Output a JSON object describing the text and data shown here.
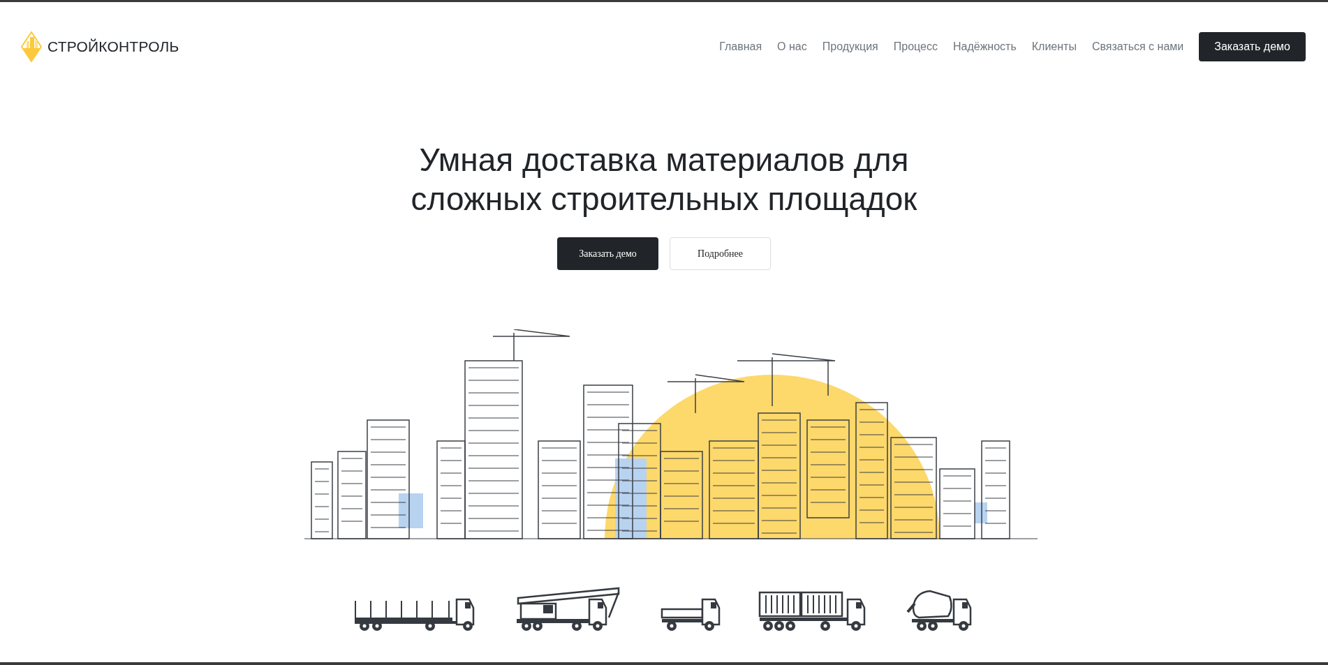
{
  "logo": {
    "text": "СТРОЙКОНТРОЛЬ"
  },
  "nav": {
    "items": [
      {
        "label": "Главная"
      },
      {
        "label": "О нас"
      },
      {
        "label": "Продукция"
      },
      {
        "label": "Процесс"
      },
      {
        "label": "Надёжность"
      },
      {
        "label": "Клиенты"
      },
      {
        "label": "Связаться с нами"
      }
    ],
    "cta": "Заказать демо"
  },
  "hero": {
    "title_lines": [
      "Умная доставка материалов для",
      "сложных строительных площадок"
    ],
    "buttons": [
      {
        "label": "Заказать демо",
        "kind": "primary"
      },
      {
        "label": "Подробнее",
        "kind": "secondary"
      }
    ]
  }
}
